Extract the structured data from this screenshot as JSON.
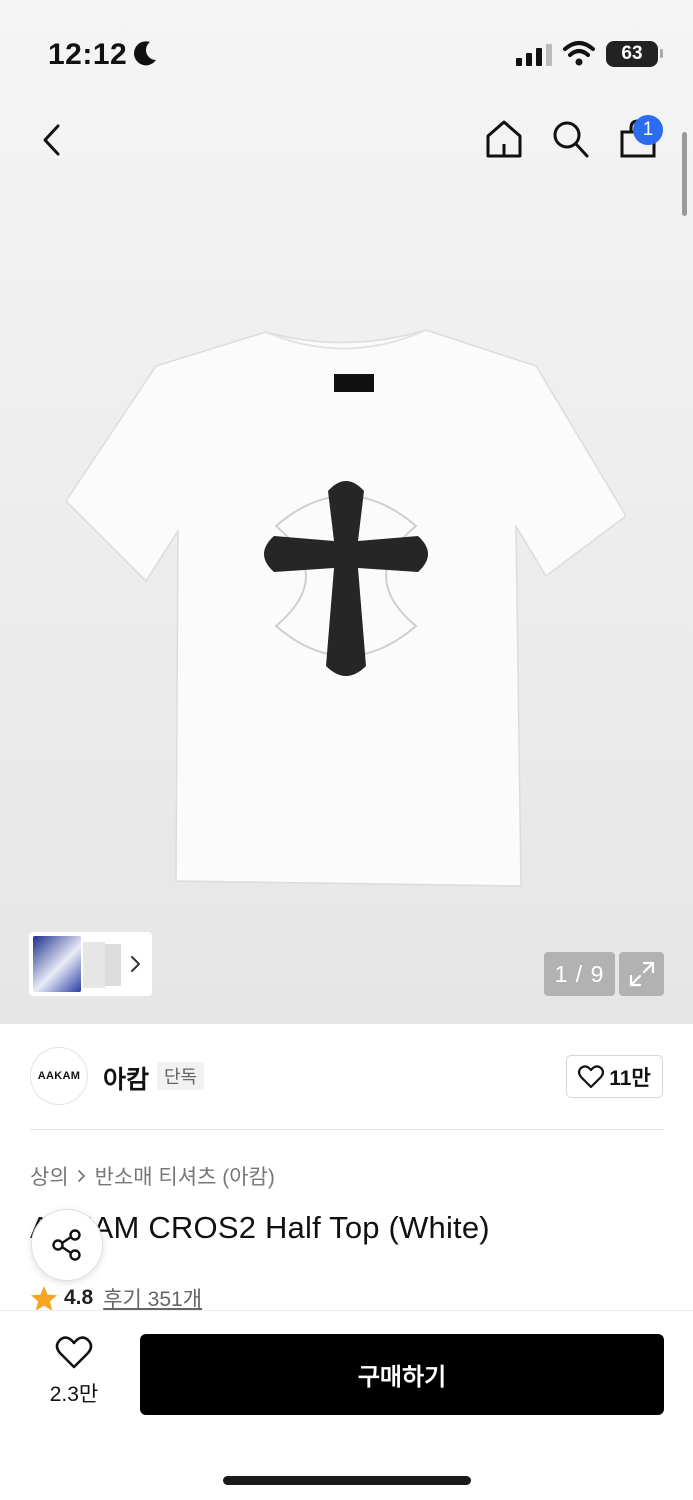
{
  "status": {
    "time": "12:12",
    "battery": "63"
  },
  "nav": {
    "cart_count": "1"
  },
  "gallery": {
    "counter": "1 / 9"
  },
  "brand": {
    "logo_text": "AAKAM",
    "name": "아캄",
    "tag": "단독",
    "fav_count": "11만"
  },
  "product": {
    "breadcrumb": [
      "상의",
      "반소매 티셔츠 (아캄)"
    ],
    "title": "AAKAM CROS2 Half Top (White)",
    "rating": "4.8",
    "reviews": "후기 351개"
  },
  "bottom": {
    "like_count": "2.3만",
    "buy_label": "구매하기"
  },
  "colors": {
    "badge": "#2b6cf0",
    "star": "#f5a623",
    "buy_bg": "#000000"
  },
  "icons": [
    "moon-icon",
    "signal-icon",
    "wifi-icon",
    "back-icon",
    "home-icon",
    "search-icon",
    "cart-icon",
    "chevron-right-icon",
    "expand-icon",
    "heart-icon",
    "share-icon",
    "star-icon"
  ]
}
